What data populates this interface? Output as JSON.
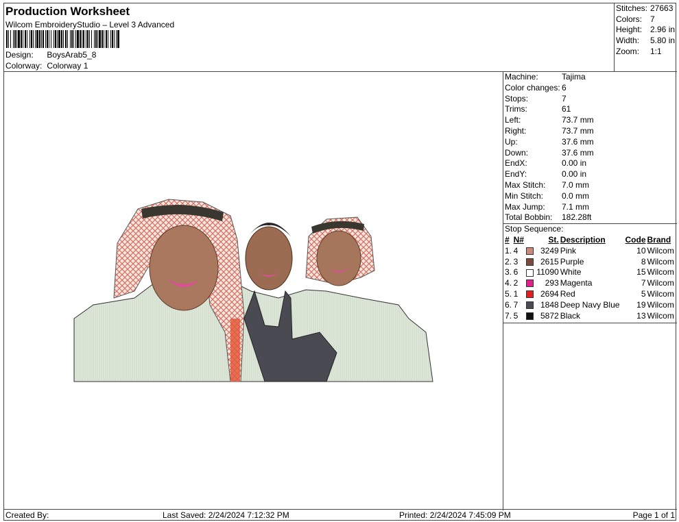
{
  "header": {
    "title": "Production Worksheet",
    "software": "Wilcom EmbroideryStudio – Level 3 Advanced",
    "design_label": "Design:",
    "design_value": "BoysArab5_8",
    "colorway_label": "Colorway:",
    "colorway_value": "Colorway 1"
  },
  "stats": [
    {
      "label": "Stitches:",
      "value": "27663"
    },
    {
      "label": "Colors:",
      "value": "7"
    },
    {
      "label": "Height:",
      "value": "2.96 in"
    },
    {
      "label": "Width:",
      "value": "5.80 in"
    },
    {
      "label": "Zoom:",
      "value": "1:1"
    }
  ],
  "machine_info": [
    {
      "label": "Machine:",
      "value": "Tajima"
    },
    {
      "label": "Color changes:",
      "value": "6"
    },
    {
      "label": "Stops:",
      "value": "7"
    },
    {
      "label": "Trims:",
      "value": "61"
    },
    {
      "label": "Left:",
      "value": "73.7 mm"
    },
    {
      "label": "Right:",
      "value": "73.7 mm"
    },
    {
      "label": "Up:",
      "value": "37.6 mm"
    },
    {
      "label": "Down:",
      "value": "37.6 mm"
    },
    {
      "label": "EndX:",
      "value": "0.00 in"
    },
    {
      "label": "EndY:",
      "value": "0.00 in"
    },
    {
      "label": "Max Stitch:",
      "value": "7.0 mm"
    },
    {
      "label": "Min Stitch:",
      "value": "0.0 mm"
    },
    {
      "label": "Max Jump:",
      "value": "7.1 mm"
    },
    {
      "label": "Total Bobbin:",
      "value": "182.28ft"
    }
  ],
  "stop_sequence": {
    "title": "Stop Sequence:",
    "headers": {
      "num": "#",
      "n": "N#",
      "st": "St.",
      "description": "Description",
      "code": "Code",
      "brand": "Brand"
    },
    "rows": [
      {
        "num": "1.",
        "n": "4",
        "color": "#c98a7a",
        "st": "3249",
        "description": "Pink",
        "code": "10",
        "brand": "Wilcom"
      },
      {
        "num": "2.",
        "n": "3",
        "color": "#7a4a3e",
        "st": "2615",
        "description": "Purple",
        "code": "8",
        "brand": "Wilcom"
      },
      {
        "num": "3.",
        "n": "6",
        "color": "#ffffff",
        "st": "11090",
        "description": "White",
        "code": "15",
        "brand": "Wilcom"
      },
      {
        "num": "4.",
        "n": "2",
        "color": "#e0208c",
        "st": "293",
        "description": "Magenta",
        "code": "7",
        "brand": "Wilcom"
      },
      {
        "num": "5.",
        "n": "1",
        "color": "#e02020",
        "st": "2694",
        "description": "Red",
        "code": "5",
        "brand": "Wilcom"
      },
      {
        "num": "6.",
        "n": "7",
        "color": "#4a4a52",
        "st": "1848",
        "description": "Deep Navy Blue",
        "code": "19",
        "brand": "Wilcom"
      },
      {
        "num": "7.",
        "n": "5",
        "color": "#111111",
        "st": "5872",
        "description": "Black",
        "code": "13",
        "brand": "Wilcom"
      }
    ]
  },
  "footer": {
    "created_by": "Created By:",
    "last_saved": "Last Saved: 2/24/2024 7:12:32 PM",
    "printed": "Printed: 2/24/2024 7:45:09 PM",
    "page": "Page 1 of 1"
  }
}
